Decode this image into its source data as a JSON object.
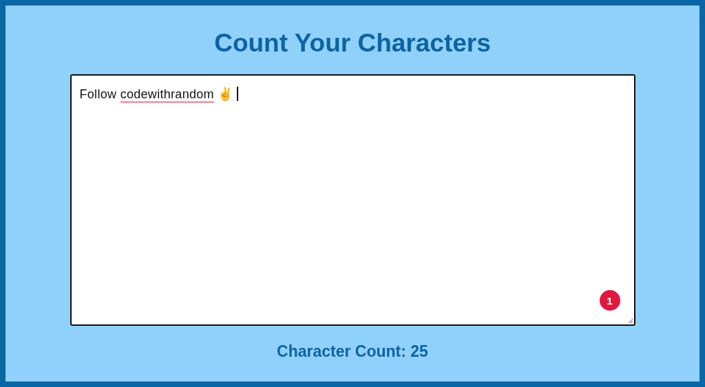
{
  "title": "Count Your Characters",
  "editor": {
    "segments": [
      {
        "text": "Follow ",
        "misspelled": false
      },
      {
        "text": "codewithrandom",
        "misspelled": true
      },
      {
        "text": " ✌️ ",
        "misspelled": false
      }
    ],
    "caret": true,
    "badge": "1"
  },
  "count_label": "Character Count: 25"
}
